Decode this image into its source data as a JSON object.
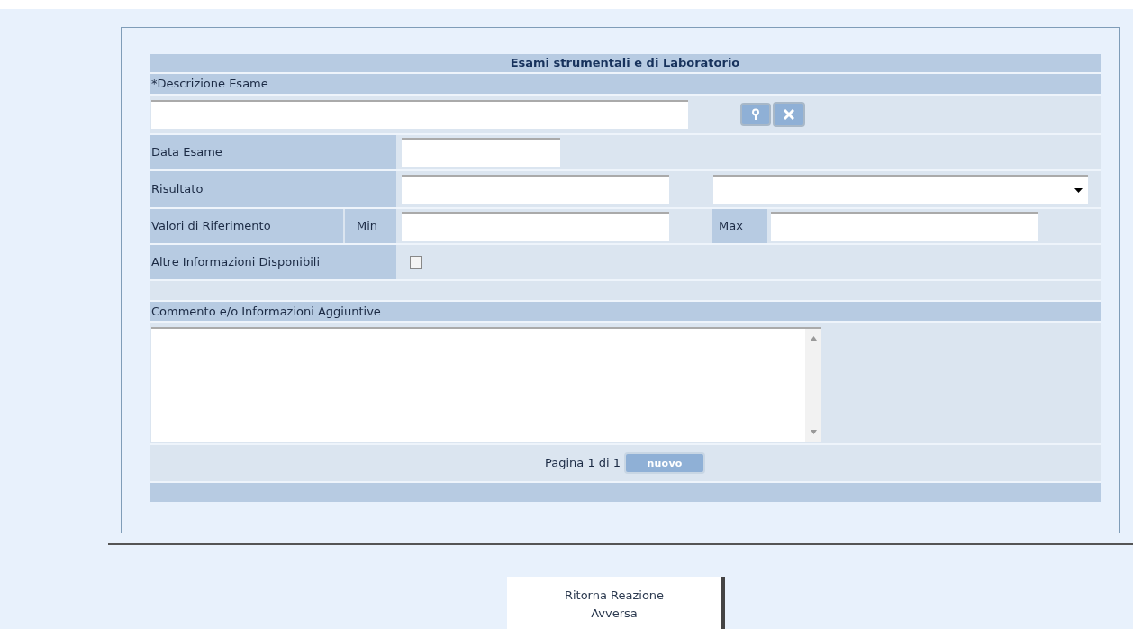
{
  "form": {
    "title": "Esami strumentali e di Laboratorio",
    "description": {
      "label": "*Descrizione Esame"
    },
    "exam_date": {
      "label": "Data Esame"
    },
    "result": {
      "label": "Risultato"
    },
    "reference_values": {
      "label": "Valori di Riferimento",
      "min_label": "Min",
      "max_label": "Max"
    },
    "other_info": {
      "label": "Altre Informazioni Disponibili",
      "checked": false
    },
    "comment": {
      "label": "Commento e/o Informazioni Aggiuntive"
    },
    "pagination": {
      "text": "Pagina 1 di 1",
      "new_button": "nuovo"
    }
  },
  "return_button": "Ritorna Reazione Avversa"
}
